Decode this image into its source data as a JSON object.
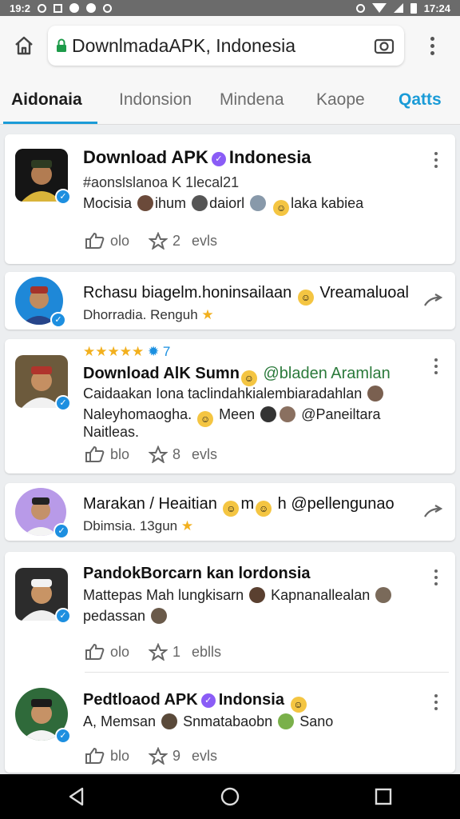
{
  "status_bar": {
    "time_left": "19:2",
    "time_right": "17:24"
  },
  "browser": {
    "url": "DownlmadaAPK, Indonesia"
  },
  "tabs": [
    "Aidonaia",
    "Indonsion",
    "Mindena",
    "Kaope",
    "Qatts"
  ],
  "colors": {
    "accent": "#1a9bd7",
    "verified": "#1d8fe0",
    "star": "#f2b01e"
  },
  "cards": [
    {
      "title": "Download APK",
      "title_suffix": "Indonesia",
      "subtitle": "#aonslslanoa  K 1lecal21",
      "line1_a": "Mocisia",
      "line1_b": "ihum",
      "line1_c": "daiorl",
      "line1_d": "laka kabiea",
      "action1": "olo",
      "action2_num": "2",
      "action2": "evls"
    },
    {
      "title": "Rchasu biagelm.honinsailaan",
      "title_suffix": "Vreamaluoal",
      "subtitle": "Dhorradia. Renguh"
    },
    {
      "rating_num": "7",
      "title": "Download AlK Sumn",
      "handle": "@bladen Aramlan",
      "line1": "Caidaakan  Iona taclindahkialembiaradahlan",
      "line2_a": "Naleyhomaogha.",
      "line2_b": "Meen",
      "line2_c": "@Paneiltara",
      "line3": "Naitleas.",
      "action1": "blo",
      "action2_num": "8",
      "action2": "evls"
    },
    {
      "title": "Marakan / Heaitian",
      "title_mid": "m",
      "title_end": "h @pellengunao",
      "subtitle": "Dbimsia. 13gun"
    },
    {
      "title": "PandokBorcarn kan lordonsia",
      "line1_a": "Mattepas Mah lungkisarn",
      "line1_b": "Kapnanallealan",
      "line2": "pedassan",
      "action1": "olo",
      "action2_num": "1",
      "action2": "eblls"
    },
    {
      "title": "Pedtloaod APK",
      "title_suffix": "Indonsia",
      "line1_a": "A, Memsan",
      "line1_b": "Snmatabaobn",
      "line1_c": "Sano",
      "action1": "blo",
      "action2_num": "9",
      "action2": "evls"
    }
  ],
  "icons": [
    "home-icon",
    "lock-icon",
    "camera-icon",
    "overflow-menu-icon",
    "share-icon",
    "like-icon",
    "star-icon",
    "verified-icon",
    "back-icon",
    "home-circle-icon",
    "recents-icon"
  ]
}
